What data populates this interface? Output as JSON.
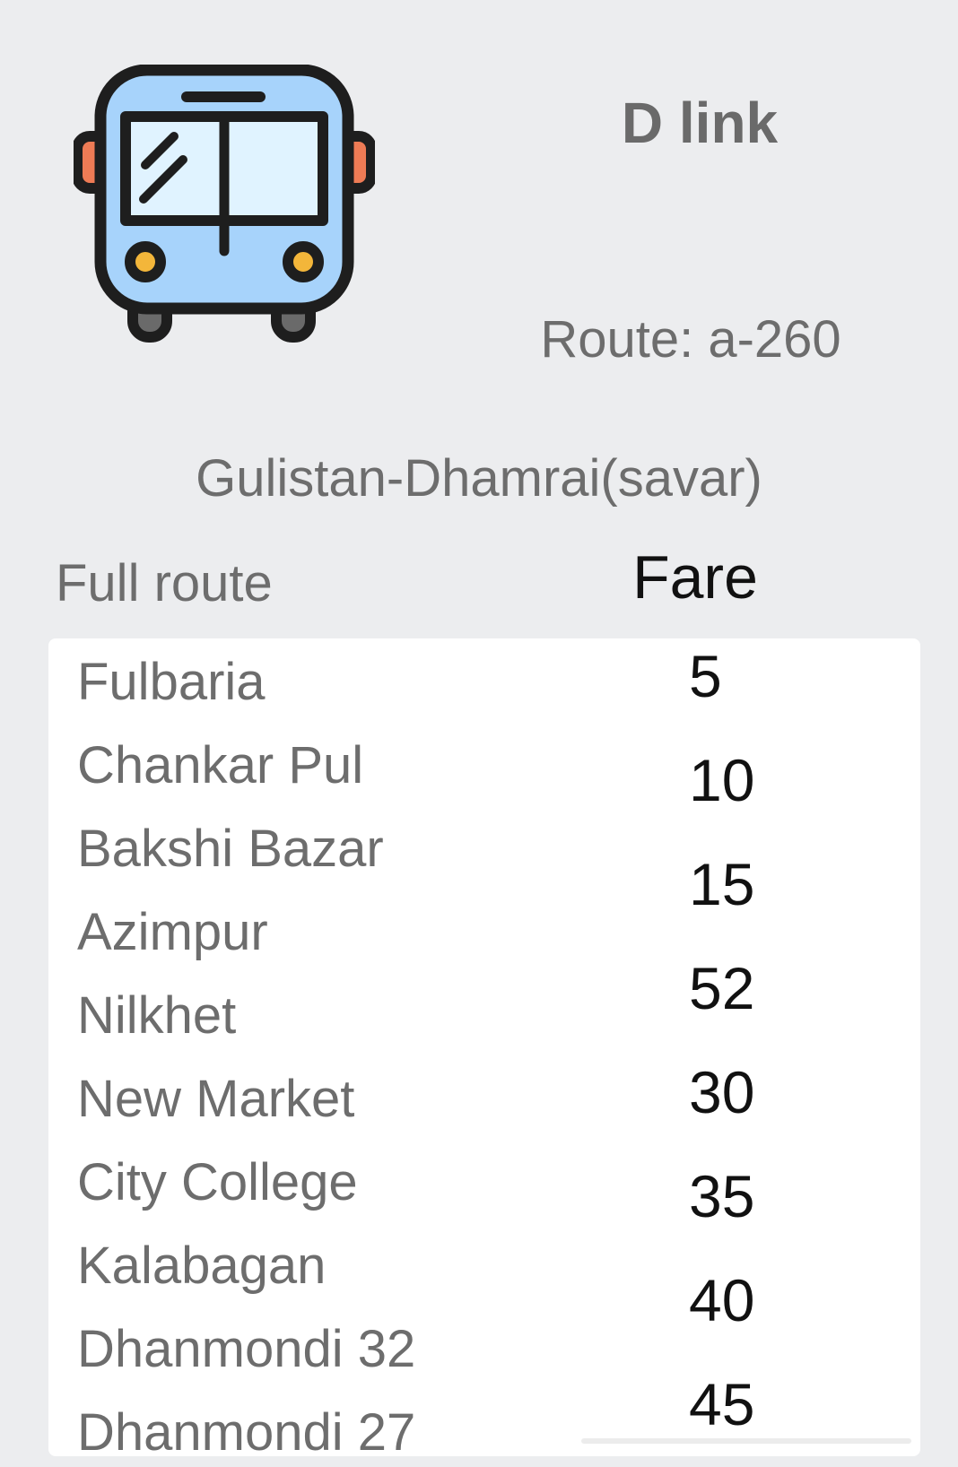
{
  "header": {
    "bus_icon": "bus-front-icon",
    "bus_name": "D link",
    "route_code": "Route: a-260",
    "route_span": "Gulistan-Dhamrai(savar)"
  },
  "table": {
    "col_route": "Full route",
    "col_fare": "Fare",
    "stops": [
      "Fulbaria",
      "Chankar Pul",
      "Bakshi Bazar",
      "Azimpur",
      "Nilkhet",
      "New Market",
      "City College",
      "Kalabagan",
      "Dhanmondi 32",
      "Dhanmondi 27"
    ],
    "fares": [
      "5",
      "10",
      "15",
      "52",
      "30",
      "35",
      "40",
      "45"
    ]
  },
  "colors": {
    "background": "#ecedef",
    "card": "#ffffff",
    "bus_body": "#a7d3fb",
    "bus_window": "#e0f3ff",
    "bus_outline": "#1e1e1e",
    "mirror": "#ee7b55",
    "headlight": "#f3b63a",
    "wheel": "#6a6a6a"
  }
}
